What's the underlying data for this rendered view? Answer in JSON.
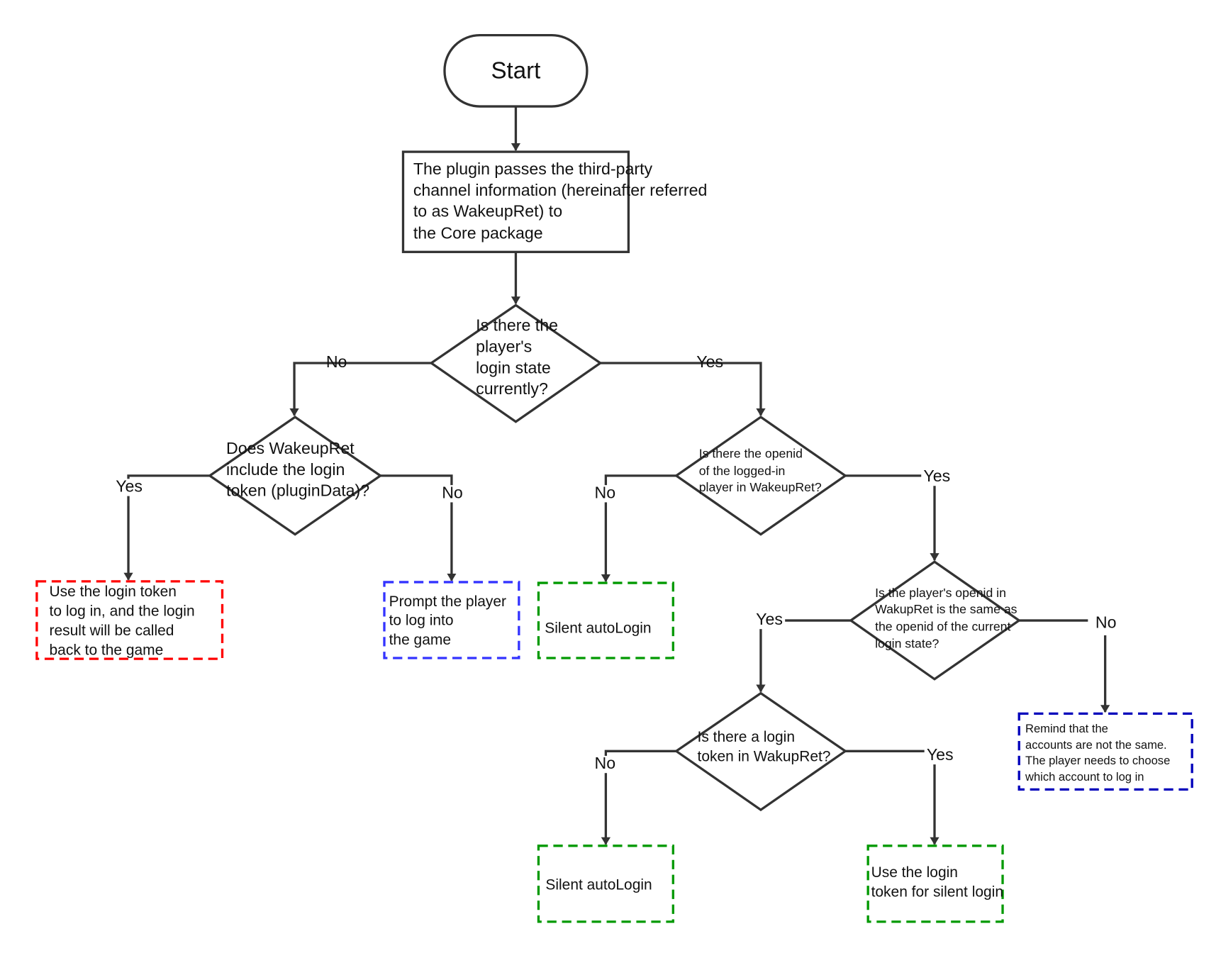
{
  "colors": {
    "line": "#333333",
    "red": "#ff0000",
    "blue": "#3333ff",
    "green": "#009900",
    "dark_blue": "#0000bb"
  },
  "nodes": {
    "start": {
      "lines": [
        "Start"
      ]
    },
    "pass_info": {
      "lines": [
        "The plugin passes the third-party",
        "channel information (hereinafter referred",
        "to as WakeupRet) to",
        "the Core package"
      ]
    },
    "login_state": {
      "lines": [
        "Is there the",
        "player's",
        "login state",
        "currently?"
      ]
    },
    "include_token": {
      "lines": [
        "Does WakeupRet",
        "include the login",
        "token (pluginData)?"
      ]
    },
    "use_token_login": {
      "lines": [
        "Use the login token",
        "to log in, and the login",
        "result will be called",
        "back to the game"
      ]
    },
    "prompt_login": {
      "lines": [
        "Prompt the player",
        "to log into",
        "the game"
      ]
    },
    "openid_exists": {
      "lines": [
        "Is there the openid",
        "of the logged-in",
        "player in WakeupRet?"
      ]
    },
    "silent_1": {
      "lines": [
        "Silent autoLogin"
      ]
    },
    "openid_same": {
      "lines": [
        "Is the player's openid in",
        "WakupRet is the same as",
        "the openid of the current",
        "login state?"
      ]
    },
    "remind": {
      "lines": [
        "Remind that the",
        "accounts are not the same.",
        "The player needs to choose",
        "which account to log in"
      ]
    },
    "token_in_ret": {
      "lines": [
        "Is there a login",
        "token in WakupRet?"
      ]
    },
    "silent_2": {
      "lines": [
        "Silent autoLogin"
      ]
    },
    "silent_token": {
      "lines": [
        "Use the login",
        "token for silent login"
      ]
    }
  },
  "edges": {
    "login_state_no": "No",
    "login_state_yes": "Yes",
    "include_token_yes": "Yes",
    "include_token_no": "No",
    "openid_exists_no": "No",
    "openid_exists_yes": "Yes",
    "openid_same_yes": "Yes",
    "openid_same_no": "No",
    "token_in_ret_no": "No",
    "token_in_ret_yes": "Yes"
  }
}
